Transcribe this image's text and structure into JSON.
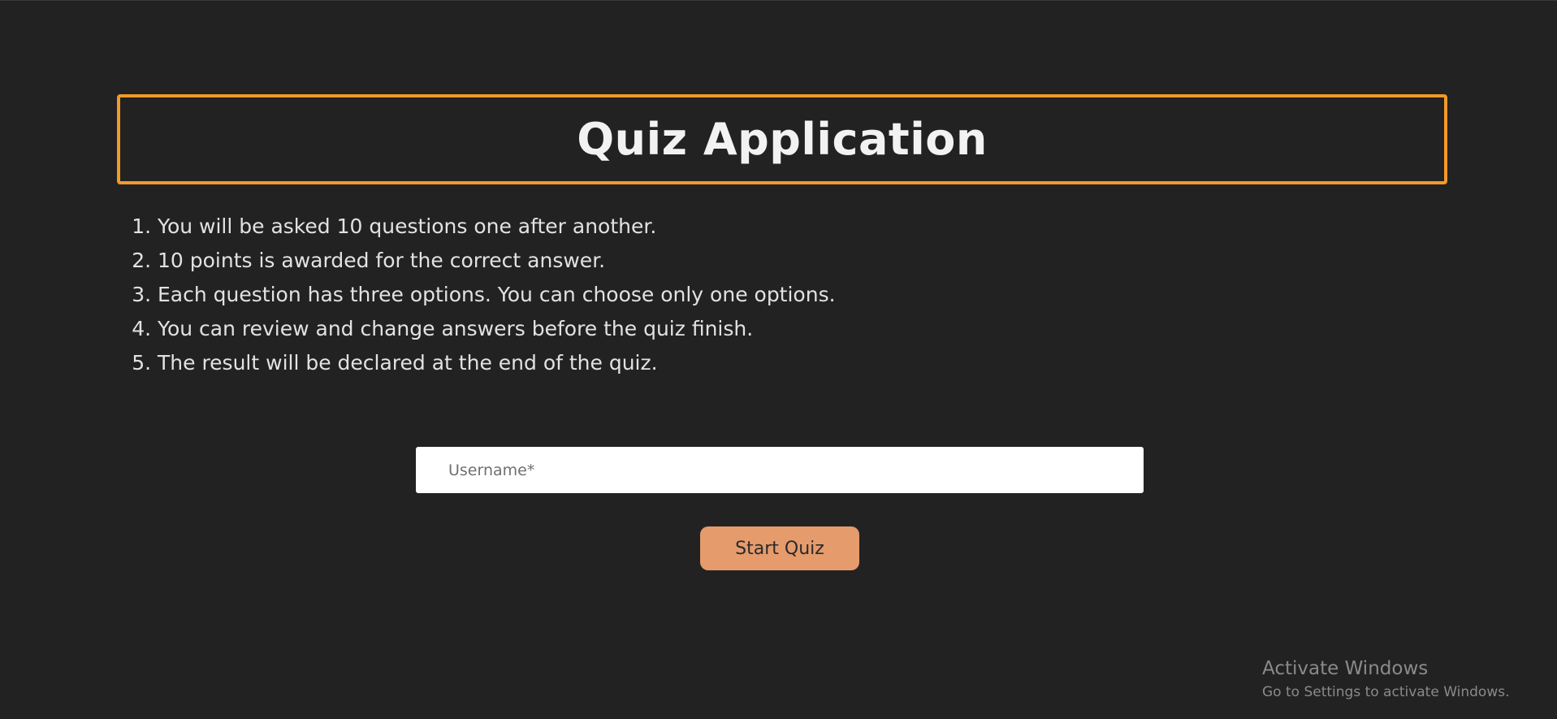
{
  "header": {
    "title": "Quiz Application"
  },
  "rules": [
    "You will be asked 10 questions one after another.",
    "10 points is awarded for the correct answer.",
    "Each question has three options. You can choose only one options.",
    "You can review and change answers before the quiz finish.",
    "The result will be declared at the end of the quiz."
  ],
  "form": {
    "username_placeholder": "Username*",
    "username_value": "",
    "start_label": "Start Quiz"
  },
  "watermark": {
    "title": "Activate Windows",
    "subtitle": "Go to Settings to activate Windows."
  },
  "colors": {
    "background": "#222222",
    "accent_border": "#f19a2a",
    "button": "#e59b6c"
  }
}
